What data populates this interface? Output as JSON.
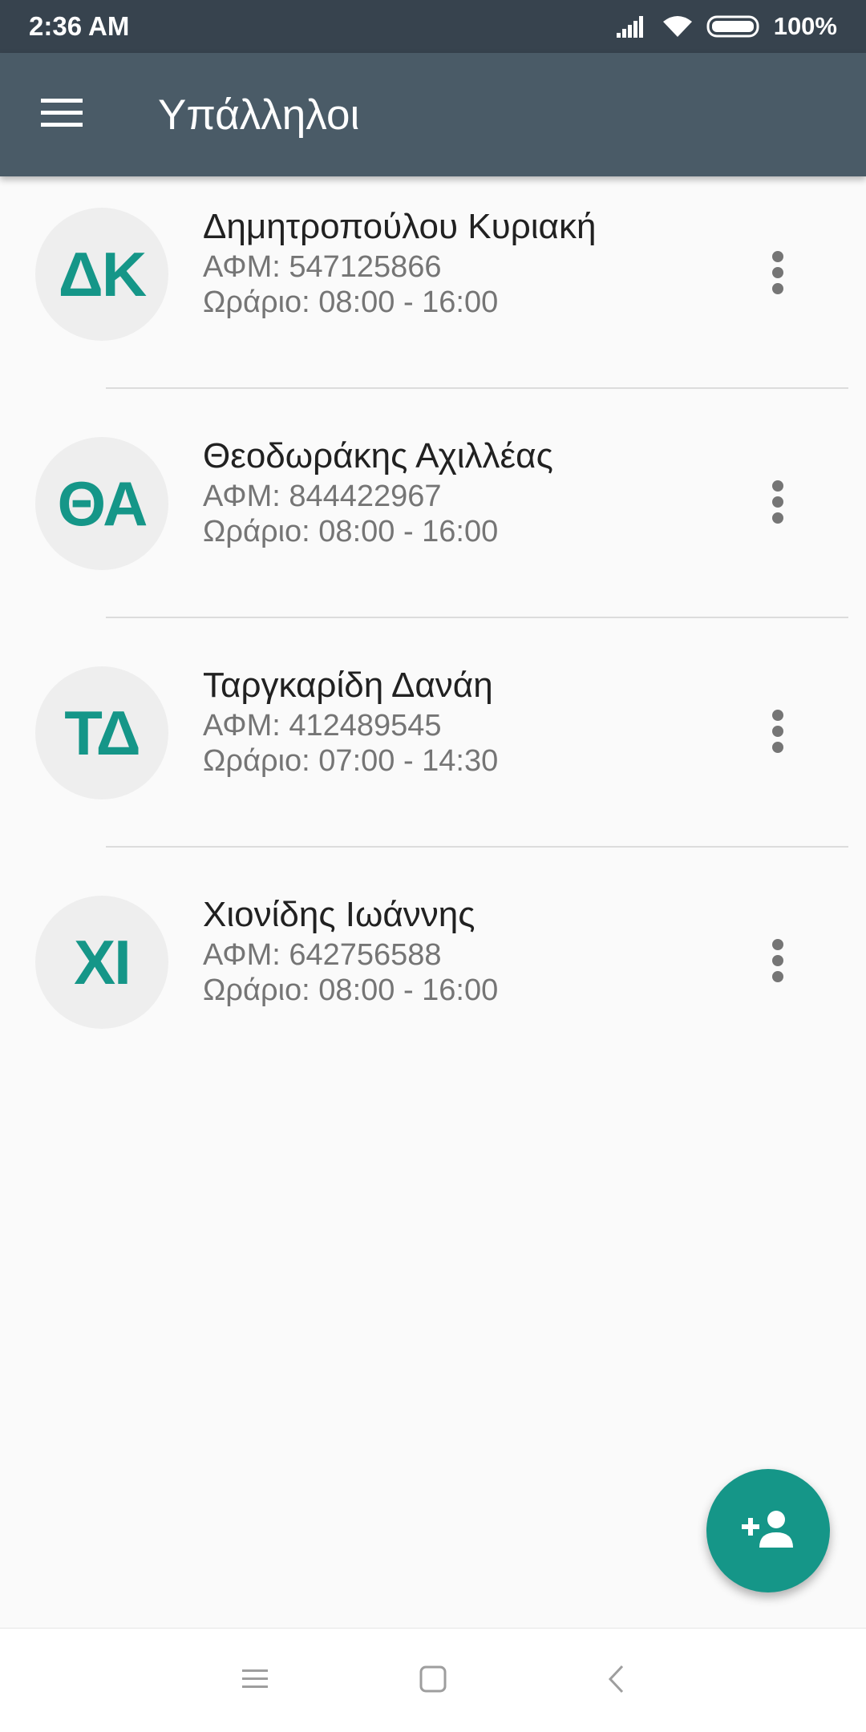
{
  "status_bar": {
    "time": "2:36 AM",
    "battery_percent": "100%",
    "icons": [
      "signal-icon",
      "wifi-icon",
      "battery-icon"
    ]
  },
  "app_bar": {
    "title": "Υπάλληλοι",
    "menu_icon": "hamburger-menu-icon"
  },
  "employees": [
    {
      "initials": "ΔΚ",
      "name": "Δημητροπούλου Κυριακή",
      "afm": "ΑΦΜ: 547125866",
      "schedule": "Ωράριο: 08:00 - 16:00"
    },
    {
      "initials": "ΘΑ",
      "name": "Θεοδωράκης Αχιλλέας",
      "afm": "ΑΦΜ: 844422967",
      "schedule": "Ωράριο: 08:00 - 16:00"
    },
    {
      "initials": "ΤΔ",
      "name": "Ταργκαρίδη Δανάη",
      "afm": "ΑΦΜ: 412489545",
      "schedule": "Ωράριο: 07:00 - 14:30"
    },
    {
      "initials": "ΧΙ",
      "name": "Χιονίδης Ιωάννης",
      "afm": "ΑΦΜ: 642756588",
      "schedule": "Ωράριο: 08:00 - 16:00"
    }
  ],
  "fab": {
    "icon": "add-person-icon"
  },
  "nav_bar": {
    "icons": [
      "recents-icon",
      "home-icon",
      "back-icon"
    ]
  },
  "colors": {
    "status_bar": "#37434e",
    "app_bar": "#4a5b67",
    "accent": "#159688",
    "background": "#fafafa"
  }
}
